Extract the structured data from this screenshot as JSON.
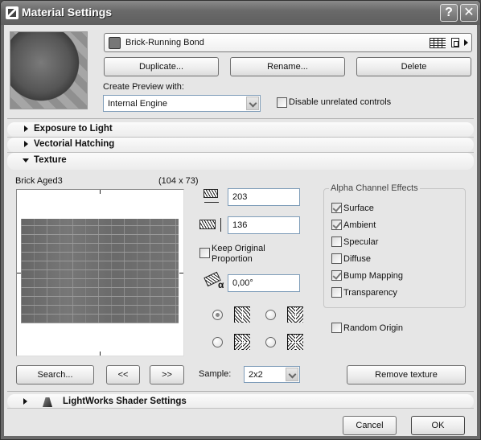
{
  "window": {
    "title": "Material Settings",
    "help_label": "?",
    "close_label": "✕"
  },
  "material": {
    "name": "Brick-Running Bond",
    "swatch_color": "#777777"
  },
  "actions": {
    "duplicate": "Duplicate...",
    "rename": "Rename...",
    "delete": "Delete"
  },
  "preview": {
    "create_label": "Create Preview with:",
    "engine_value": "Internal Engine",
    "disable_label": "Disable unrelated controls",
    "disable_checked": false
  },
  "sections": {
    "exposure": "Exposure to Light",
    "hatching": "Vectorial Hatching",
    "texture": "Texture",
    "lightworks": "LightWorks Shader Settings"
  },
  "texture": {
    "name": "Brick Aged3",
    "dimensions": "(104 x 73)",
    "width_value": "203",
    "height_value": "136",
    "keep_proportion_label": "Keep Original Proportion",
    "keep_proportion_line1": "Keep Original",
    "keep_proportion_line2": "Proportion",
    "keep_proportion_checked": false,
    "angle_value": "0,00°",
    "mirror_options_selected": 0,
    "search_label": "Search...",
    "prev_label": "<<",
    "next_label": ">>",
    "sample_label": "Sample:",
    "sample_value": "2x2",
    "remove_label": "Remove texture",
    "random_origin_label": "Random Origin",
    "random_origin_checked": false
  },
  "alpha": {
    "title": "Alpha Channel Effects",
    "items": [
      {
        "label": "Surface",
        "checked": true
      },
      {
        "label": "Ambient",
        "checked": true
      },
      {
        "label": "Specular",
        "checked": false
      },
      {
        "label": "Diffuse",
        "checked": false
      },
      {
        "label": "Bump Mapping",
        "checked": true
      },
      {
        "label": "Transparency",
        "checked": false
      }
    ]
  },
  "footer": {
    "cancel": "Cancel",
    "ok": "OK"
  }
}
